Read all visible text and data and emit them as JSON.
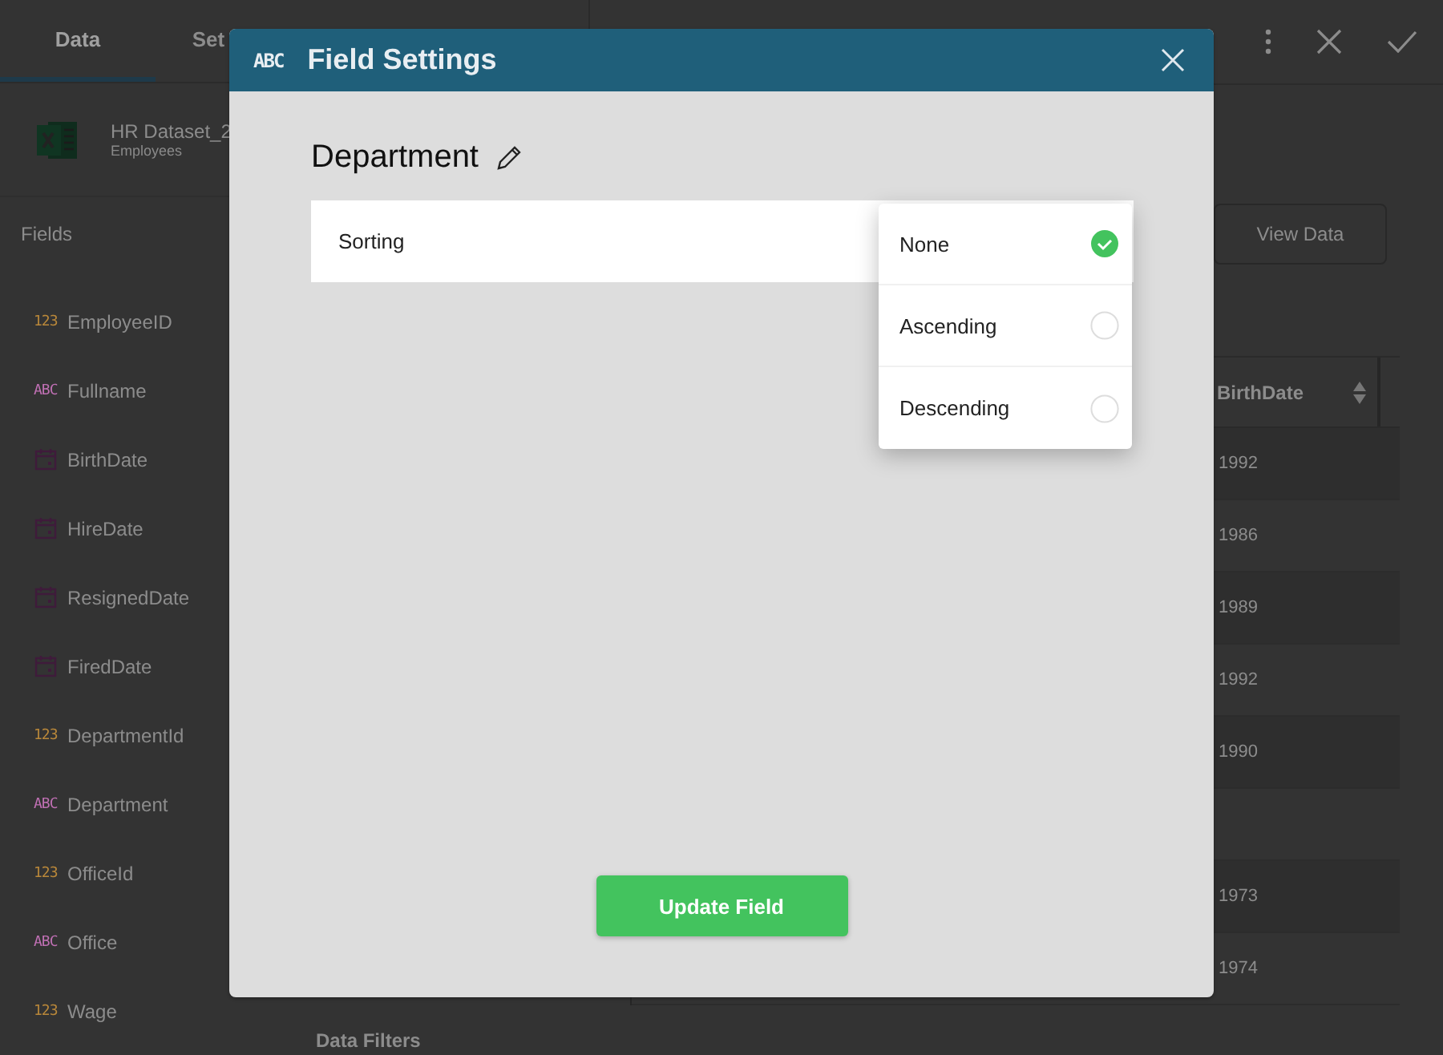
{
  "sidebar": {
    "tabs": [
      {
        "label": "Data",
        "selected": true
      },
      {
        "label": "Set",
        "selected": false
      }
    ],
    "dataset": {
      "name": "HR Dataset_2",
      "subtitle": "Employees"
    },
    "fields_heading": "Fields",
    "fields": [
      {
        "kind": "number",
        "badge": "123",
        "name": "EmployeeID"
      },
      {
        "kind": "text",
        "badge": "ABC",
        "name": "Fullname"
      },
      {
        "kind": "date",
        "name": "BirthDate"
      },
      {
        "kind": "date",
        "name": "HireDate"
      },
      {
        "kind": "date",
        "name": "ResignedDate"
      },
      {
        "kind": "date",
        "name": "FiredDate"
      },
      {
        "kind": "number",
        "badge": "123",
        "name": "DepartmentId"
      },
      {
        "kind": "text",
        "badge": "ABC",
        "name": "Department"
      },
      {
        "kind": "number",
        "badge": "123",
        "name": "OfficeId"
      },
      {
        "kind": "text",
        "badge": "ABC",
        "name": "Office"
      },
      {
        "kind": "number",
        "badge": "123",
        "name": "Wage"
      }
    ],
    "data_filters_heading": "Data Filters"
  },
  "main": {
    "view_data_button": "View Data",
    "table": {
      "columns": [
        {
          "label": "BirthDate"
        }
      ],
      "rows": [
        {
          "birth_date": "1992"
        },
        {
          "birth_date": "1986"
        },
        {
          "birth_date": "1989"
        },
        {
          "birth_date": "1992"
        },
        {
          "birth_date": "1990"
        },
        {},
        {
          "birth_date": "1973"
        },
        {
          "birth_date": "1974"
        }
      ]
    }
  },
  "dialog": {
    "type_badge": "ABC",
    "title": "Field Settings",
    "field_name": "Department",
    "setting_label": "Sorting",
    "options": [
      {
        "label": "None",
        "selected": true
      },
      {
        "label": "Ascending",
        "selected": false
      },
      {
        "label": "Descending",
        "selected": false
      }
    ],
    "button": "Update Field"
  }
}
